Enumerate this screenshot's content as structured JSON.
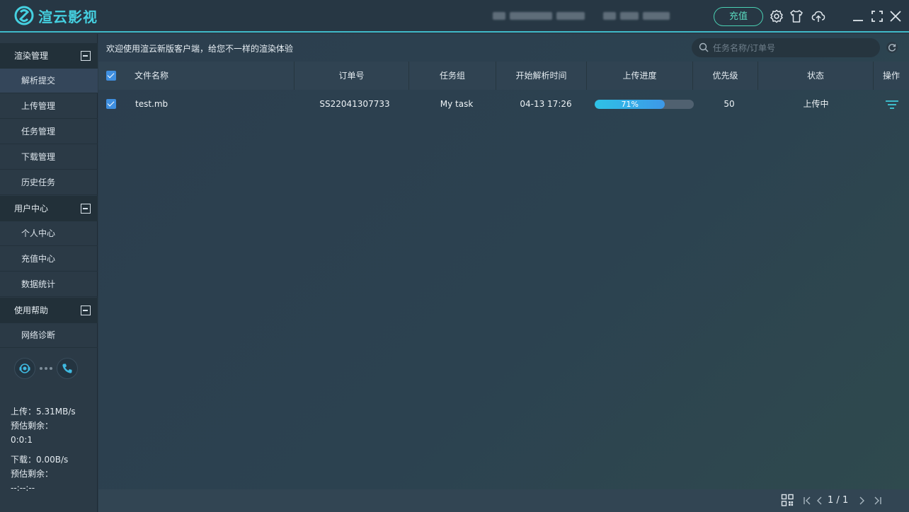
{
  "app": {
    "title": "渲云影视",
    "recharge_label": "充值"
  },
  "sidebar": {
    "groups": [
      {
        "label": "渲染管理",
        "items": [
          "解析提交",
          "上传管理",
          "任务管理",
          "下载管理",
          "历史任务"
        ]
      },
      {
        "label": "用户中心",
        "items": [
          "个人中心",
          "充值中心",
          "数据统计"
        ]
      },
      {
        "label": "使用帮助",
        "items": [
          "网络诊断"
        ]
      }
    ],
    "active_item": "解析提交",
    "stats": {
      "upload_label": "上传：",
      "upload_value": "5.31MB/s",
      "upload_eta_label": "预估剩余：",
      "upload_eta_value": "0:0:1",
      "download_label": "下载：",
      "download_value": "0.00B/s",
      "download_eta_label": "预估剩余：",
      "download_eta_value": "--:--:--"
    }
  },
  "main": {
    "welcome": "欢迎使用渲云新版客户端，给您不一样的渲染体验",
    "search_placeholder": "任务名称/订单号",
    "table": {
      "headers": [
        "文件名称",
        "订单号",
        "任务组",
        "开始解析时间",
        "上传进度",
        "优先级",
        "状态",
        "操作"
      ],
      "rows": [
        {
          "file_name": "test.mb",
          "order_no": "SS22041307733",
          "task_group": "My task",
          "start_time": "04-13 17:26",
          "progress": 71,
          "progress_label": "71%",
          "priority": "50",
          "status": "上传中"
        }
      ]
    },
    "pager": {
      "current": "1",
      "separator": "/",
      "total": "1"
    }
  },
  "colors": {
    "accent": "#45d0e0",
    "recharge_border": "#4bd2b4",
    "checkbox": "#3f8fe0",
    "progress_start": "#2ec2e6",
    "progress_end": "#3d98e8"
  }
}
